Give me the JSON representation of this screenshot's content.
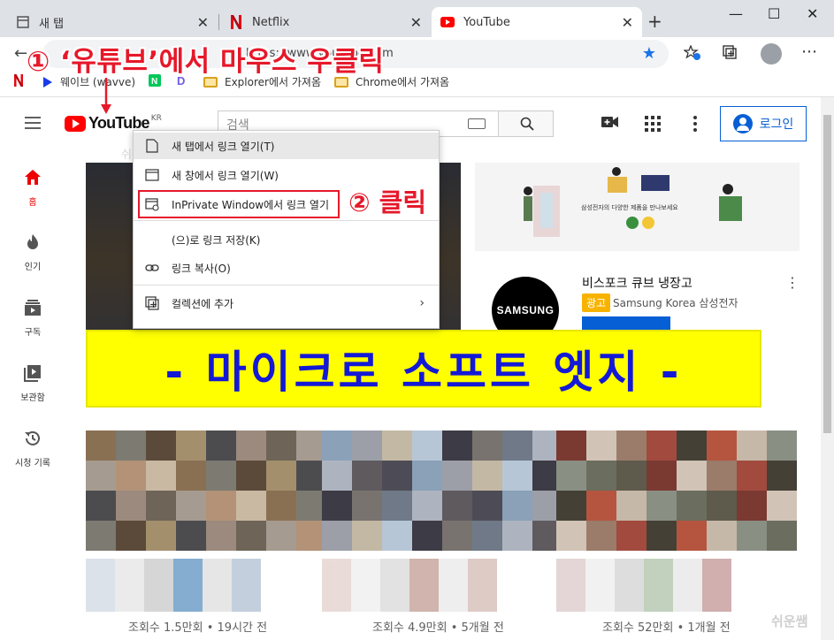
{
  "browser": {
    "tabs": [
      {
        "label": "새 탭"
      },
      {
        "label": "Netflix"
      },
      {
        "label": "YouTube"
      }
    ],
    "tab_close": "✕",
    "new_tab": "+",
    "window_controls": {
      "minimize": "—",
      "maximize": "☐",
      "close": "✕"
    },
    "url_fragment": "https://www.youtube.com",
    "bookmarks": [
      {
        "label": "웨이브 (wavve)"
      },
      {
        "label": "Explorer에서 가져옴"
      },
      {
        "label": "Chrome에서 가져옴"
      }
    ],
    "accent": "#1a73e8"
  },
  "annotations": {
    "step1": "① ‘유튜브’에서 마우스 우클릭",
    "step2": "② 클릭",
    "color": "#e6182a"
  },
  "youtube": {
    "logo_text": "YouTube",
    "region": "KR",
    "search_placeholder": "검색",
    "login_label": "로그인",
    "sidebar": [
      {
        "label": "홈",
        "icon": "home-icon"
      },
      {
        "label": "인기",
        "icon": "fire-icon"
      },
      {
        "label": "구독",
        "icon": "subscriptions-icon"
      },
      {
        "label": "보관함",
        "icon": "library-icon"
      },
      {
        "label": "시청 기록",
        "icon": "history-icon"
      }
    ],
    "ad": {
      "title": "비스포크 큐브 냉장고",
      "badge": "광고",
      "brand": "Samsung Korea 삼성전자",
      "logo": "SAMSUNG",
      "banner_caption": "삼성전자의 다양한 제품을 만나보세요"
    },
    "video_meta": [
      "조회수 1.5만회 • 19시간 전",
      "조회수 4.9만회 • 5개월 전",
      "조회수 52만회 • 1개월 전"
    ],
    "watermark": "쉬운쌤"
  },
  "context_menu": {
    "items": [
      {
        "label": "새 탭에서 링크 열기(T)",
        "icon": "new-tab-icon"
      },
      {
        "label": "새 창에서 링크 열기(W)",
        "icon": "new-window-icon"
      },
      {
        "label": "InPrivate Window에서 링크 열기",
        "icon": "inprivate-icon"
      },
      {
        "label": "(으)로 링크 저장(K)",
        "icon": ""
      },
      {
        "label": "링크 복사(O)",
        "icon": "link-icon"
      },
      {
        "label": "컬렉션에 추가",
        "icon": "collection-icon"
      }
    ]
  },
  "banner": {
    "text": "- 마이크로 소프트 엣지 -",
    "bg": "#ffff00",
    "color": "#1419d6"
  }
}
